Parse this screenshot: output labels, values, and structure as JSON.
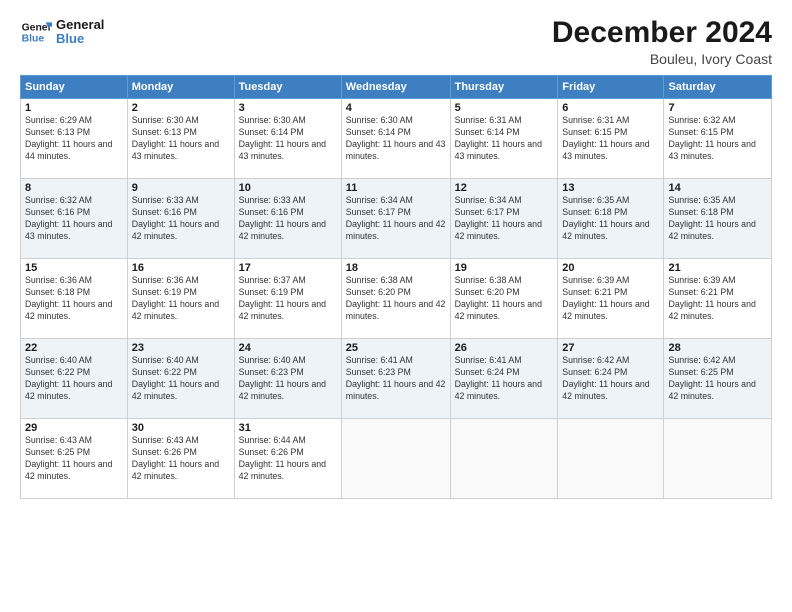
{
  "logo": {
    "line1": "General",
    "line2": "Blue"
  },
  "title": "December 2024",
  "subtitle": "Bouleu, Ivory Coast",
  "days_of_week": [
    "Sunday",
    "Monday",
    "Tuesday",
    "Wednesday",
    "Thursday",
    "Friday",
    "Saturday"
  ],
  "weeks": [
    [
      {
        "day": "1",
        "sunrise": "6:29 AM",
        "sunset": "6:13 PM",
        "daylight": "11 hours and 44 minutes."
      },
      {
        "day": "2",
        "sunrise": "6:30 AM",
        "sunset": "6:13 PM",
        "daylight": "11 hours and 43 minutes."
      },
      {
        "day": "3",
        "sunrise": "6:30 AM",
        "sunset": "6:14 PM",
        "daylight": "11 hours and 43 minutes."
      },
      {
        "day": "4",
        "sunrise": "6:30 AM",
        "sunset": "6:14 PM",
        "daylight": "11 hours and 43 minutes."
      },
      {
        "day": "5",
        "sunrise": "6:31 AM",
        "sunset": "6:14 PM",
        "daylight": "11 hours and 43 minutes."
      },
      {
        "day": "6",
        "sunrise": "6:31 AM",
        "sunset": "6:15 PM",
        "daylight": "11 hours and 43 minutes."
      },
      {
        "day": "7",
        "sunrise": "6:32 AM",
        "sunset": "6:15 PM",
        "daylight": "11 hours and 43 minutes."
      }
    ],
    [
      {
        "day": "8",
        "sunrise": "6:32 AM",
        "sunset": "6:16 PM",
        "daylight": "11 hours and 43 minutes."
      },
      {
        "day": "9",
        "sunrise": "6:33 AM",
        "sunset": "6:16 PM",
        "daylight": "11 hours and 42 minutes."
      },
      {
        "day": "10",
        "sunrise": "6:33 AM",
        "sunset": "6:16 PM",
        "daylight": "11 hours and 42 minutes."
      },
      {
        "day": "11",
        "sunrise": "6:34 AM",
        "sunset": "6:17 PM",
        "daylight": "11 hours and 42 minutes."
      },
      {
        "day": "12",
        "sunrise": "6:34 AM",
        "sunset": "6:17 PM",
        "daylight": "11 hours and 42 minutes."
      },
      {
        "day": "13",
        "sunrise": "6:35 AM",
        "sunset": "6:18 PM",
        "daylight": "11 hours and 42 minutes."
      },
      {
        "day": "14",
        "sunrise": "6:35 AM",
        "sunset": "6:18 PM",
        "daylight": "11 hours and 42 minutes."
      }
    ],
    [
      {
        "day": "15",
        "sunrise": "6:36 AM",
        "sunset": "6:18 PM",
        "daylight": "11 hours and 42 minutes."
      },
      {
        "day": "16",
        "sunrise": "6:36 AM",
        "sunset": "6:19 PM",
        "daylight": "11 hours and 42 minutes."
      },
      {
        "day": "17",
        "sunrise": "6:37 AM",
        "sunset": "6:19 PM",
        "daylight": "11 hours and 42 minutes."
      },
      {
        "day": "18",
        "sunrise": "6:38 AM",
        "sunset": "6:20 PM",
        "daylight": "11 hours and 42 minutes."
      },
      {
        "day": "19",
        "sunrise": "6:38 AM",
        "sunset": "6:20 PM",
        "daylight": "11 hours and 42 minutes."
      },
      {
        "day": "20",
        "sunrise": "6:39 AM",
        "sunset": "6:21 PM",
        "daylight": "11 hours and 42 minutes."
      },
      {
        "day": "21",
        "sunrise": "6:39 AM",
        "sunset": "6:21 PM",
        "daylight": "11 hours and 42 minutes."
      }
    ],
    [
      {
        "day": "22",
        "sunrise": "6:40 AM",
        "sunset": "6:22 PM",
        "daylight": "11 hours and 42 minutes."
      },
      {
        "day": "23",
        "sunrise": "6:40 AM",
        "sunset": "6:22 PM",
        "daylight": "11 hours and 42 minutes."
      },
      {
        "day": "24",
        "sunrise": "6:40 AM",
        "sunset": "6:23 PM",
        "daylight": "11 hours and 42 minutes."
      },
      {
        "day": "25",
        "sunrise": "6:41 AM",
        "sunset": "6:23 PM",
        "daylight": "11 hours and 42 minutes."
      },
      {
        "day": "26",
        "sunrise": "6:41 AM",
        "sunset": "6:24 PM",
        "daylight": "11 hours and 42 minutes."
      },
      {
        "day": "27",
        "sunrise": "6:42 AM",
        "sunset": "6:24 PM",
        "daylight": "11 hours and 42 minutes."
      },
      {
        "day": "28",
        "sunrise": "6:42 AM",
        "sunset": "6:25 PM",
        "daylight": "11 hours and 42 minutes."
      }
    ],
    [
      {
        "day": "29",
        "sunrise": "6:43 AM",
        "sunset": "6:25 PM",
        "daylight": "11 hours and 42 minutes."
      },
      {
        "day": "30",
        "sunrise": "6:43 AM",
        "sunset": "6:26 PM",
        "daylight": "11 hours and 42 minutes."
      },
      {
        "day": "31",
        "sunrise": "6:44 AM",
        "sunset": "6:26 PM",
        "daylight": "11 hours and 42 minutes."
      },
      null,
      null,
      null,
      null
    ]
  ]
}
